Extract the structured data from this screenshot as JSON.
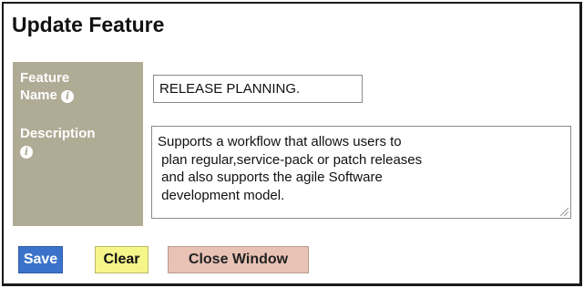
{
  "dialog": {
    "title": "Update Feature"
  },
  "form": {
    "name_label_line1": "Feature",
    "name_label_line2": "Name",
    "name_value": "RELEASE PLANNING.",
    "description_label": "Description",
    "description_value": "Supports a workflow that allows users to\n plan regular,service-pack or patch releases\n and also supports the agile Software\n development model.",
    "info_icon": "info-icon",
    "label_panel_color": "#b0ab95"
  },
  "buttons": {
    "save_label": "Save",
    "clear_label": "Clear",
    "close_label": "Close Window",
    "save_color": "#3a73c9",
    "clear_color": "#f5f58a",
    "close_color": "#e8c2b5"
  }
}
